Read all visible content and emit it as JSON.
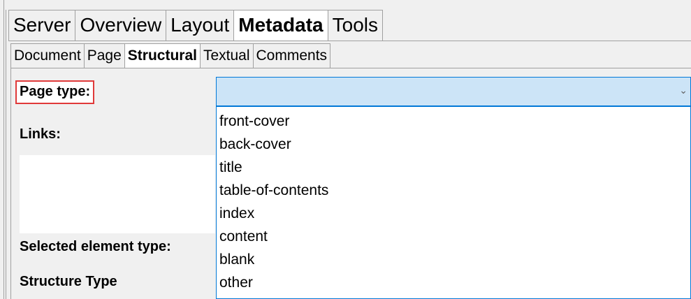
{
  "main_tabs": [
    {
      "label": "Server",
      "active": false
    },
    {
      "label": "Overview",
      "active": false
    },
    {
      "label": "Layout",
      "active": false
    },
    {
      "label": "Metadata",
      "active": true
    },
    {
      "label": "Tools",
      "active": false
    }
  ],
  "sub_tabs": [
    {
      "label": "Document",
      "active": false
    },
    {
      "label": "Page",
      "active": false
    },
    {
      "label": "Structural",
      "active": true
    },
    {
      "label": "Textual",
      "active": false
    },
    {
      "label": "Comments",
      "active": false
    }
  ],
  "fields": {
    "page_type_label": "Page type:",
    "links_label": "Links:",
    "selected_element_type_label": "Selected element type:",
    "structure_type_label": "Structure Type"
  },
  "page_type_combo": {
    "selected_value": "",
    "options": [
      "front-cover",
      "back-cover",
      "title",
      "table-of-contents",
      "index",
      "content",
      "blank",
      "other"
    ]
  },
  "icons": {
    "combo_arrow": "chevron-down-icon"
  },
  "colors": {
    "highlight_border": "#e03a3a",
    "combo_focus_bg": "#cce4f7",
    "combo_focus_border": "#0078d7"
  }
}
